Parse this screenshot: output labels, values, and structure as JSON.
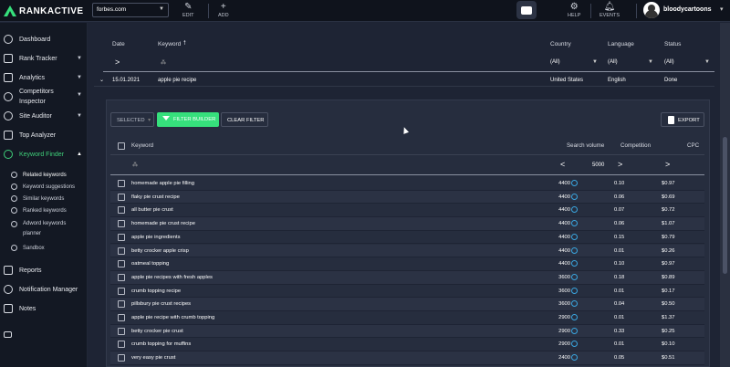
{
  "brand": {
    "name": "RANKACTIVE",
    "accent": "#36e07c"
  },
  "header": {
    "site": "forbes.com",
    "edit": "EDIT",
    "add": "ADD",
    "help": "HELP",
    "events": "EVENTS",
    "username": "bloodycartoons"
  },
  "sidebar": {
    "items": [
      {
        "label": "Dashboard",
        "icon": "gauge-icon"
      },
      {
        "label": "Rank Tracker",
        "icon": "trophy-icon"
      },
      {
        "label": "Analytics",
        "icon": "chart-icon"
      },
      {
        "label": "Competitors",
        "label2": "Inspector",
        "icon": "target-icon"
      },
      {
        "label": "Site Auditor",
        "icon": "search-icon"
      },
      {
        "label": "Top Analyzer",
        "icon": "trophy-icon"
      },
      {
        "label": "Keyword Finder",
        "icon": "key-icon"
      },
      {
        "label": "Reports",
        "icon": "report-icon"
      },
      {
        "label": "Notification Manager",
        "icon": "bell-icon"
      },
      {
        "label": "Notes",
        "icon": "note-icon"
      }
    ],
    "sub_items": [
      {
        "label": "Related keywords"
      },
      {
        "label": "Keyword suggestions"
      },
      {
        "label": "Similar keywords"
      },
      {
        "label": "Ranked keywords"
      },
      {
        "label": "Adword keywords",
        "label2": "planner"
      },
      {
        "label": "Sandbox"
      }
    ]
  },
  "outer_table": {
    "headers": {
      "date": "Date",
      "keyword": "Keyword",
      "country": "Country",
      "language": "Language",
      "status": "Status"
    },
    "filters": {
      "date": ">",
      "country": "(All)",
      "language": "(All)",
      "status": "(All)"
    },
    "row": {
      "date": "15.01.2021",
      "keyword": "apple pie recipe",
      "country": "United States",
      "language": "English",
      "status": "Done"
    }
  },
  "toolbar": {
    "selected": "SELECTED",
    "filter_builder": "FILTER BUILDER",
    "clear_filter": "CLEAR FILTER",
    "export": "EXPORT"
  },
  "kw_table": {
    "headers": {
      "keyword": "Keyword",
      "search_volume": "Search volume",
      "competition": "Competition",
      "cpc": "CPC"
    },
    "filters": {
      "sv_op": "<",
      "sv_value": "5000",
      "comp_op": ">",
      "cpc_op": ">"
    },
    "rows": [
      {
        "keyword": "homemade apple pie filling",
        "sv": "4400",
        "comp": "0.10",
        "cpc": "$0.97"
      },
      {
        "keyword": "flaky pie crust recipe",
        "sv": "4400",
        "comp": "0.06",
        "cpc": "$0.69"
      },
      {
        "keyword": "all butter pie crust",
        "sv": "4400",
        "comp": "0.07",
        "cpc": "$0.72"
      },
      {
        "keyword": "homemade pie crust recipe",
        "sv": "4400",
        "comp": "0.06",
        "cpc": "$1.07"
      },
      {
        "keyword": "apple pie ingredients",
        "sv": "4400",
        "comp": "0.15",
        "cpc": "$0.79"
      },
      {
        "keyword": "betty crocker apple crisp",
        "sv": "4400",
        "comp": "0.01",
        "cpc": "$0.26"
      },
      {
        "keyword": "oatmeal topping",
        "sv": "4400",
        "comp": "0.10",
        "cpc": "$0.97"
      },
      {
        "keyword": "apple pie recipes with fresh apples",
        "sv": "3600",
        "comp": "0.18",
        "cpc": "$0.89"
      },
      {
        "keyword": "crumb topping recipe",
        "sv": "3600",
        "comp": "0.01",
        "cpc": "$0.17"
      },
      {
        "keyword": "pillsbury pie crust recipes",
        "sv": "3600",
        "comp": "0.04",
        "cpc": "$0.50"
      },
      {
        "keyword": "apple pie recipe with crumb topping",
        "sv": "2900",
        "comp": "0.01",
        "cpc": "$1.37"
      },
      {
        "keyword": "betty crocker pie crust",
        "sv": "2900",
        "comp": "0.33",
        "cpc": "$0.25"
      },
      {
        "keyword": "crumb topping for muffins",
        "sv": "2900",
        "comp": "0.01",
        "cpc": "$0.10"
      },
      {
        "keyword": "very easy pie crust",
        "sv": "2400",
        "comp": "0.05",
        "cpc": "$0.51"
      }
    ]
  }
}
